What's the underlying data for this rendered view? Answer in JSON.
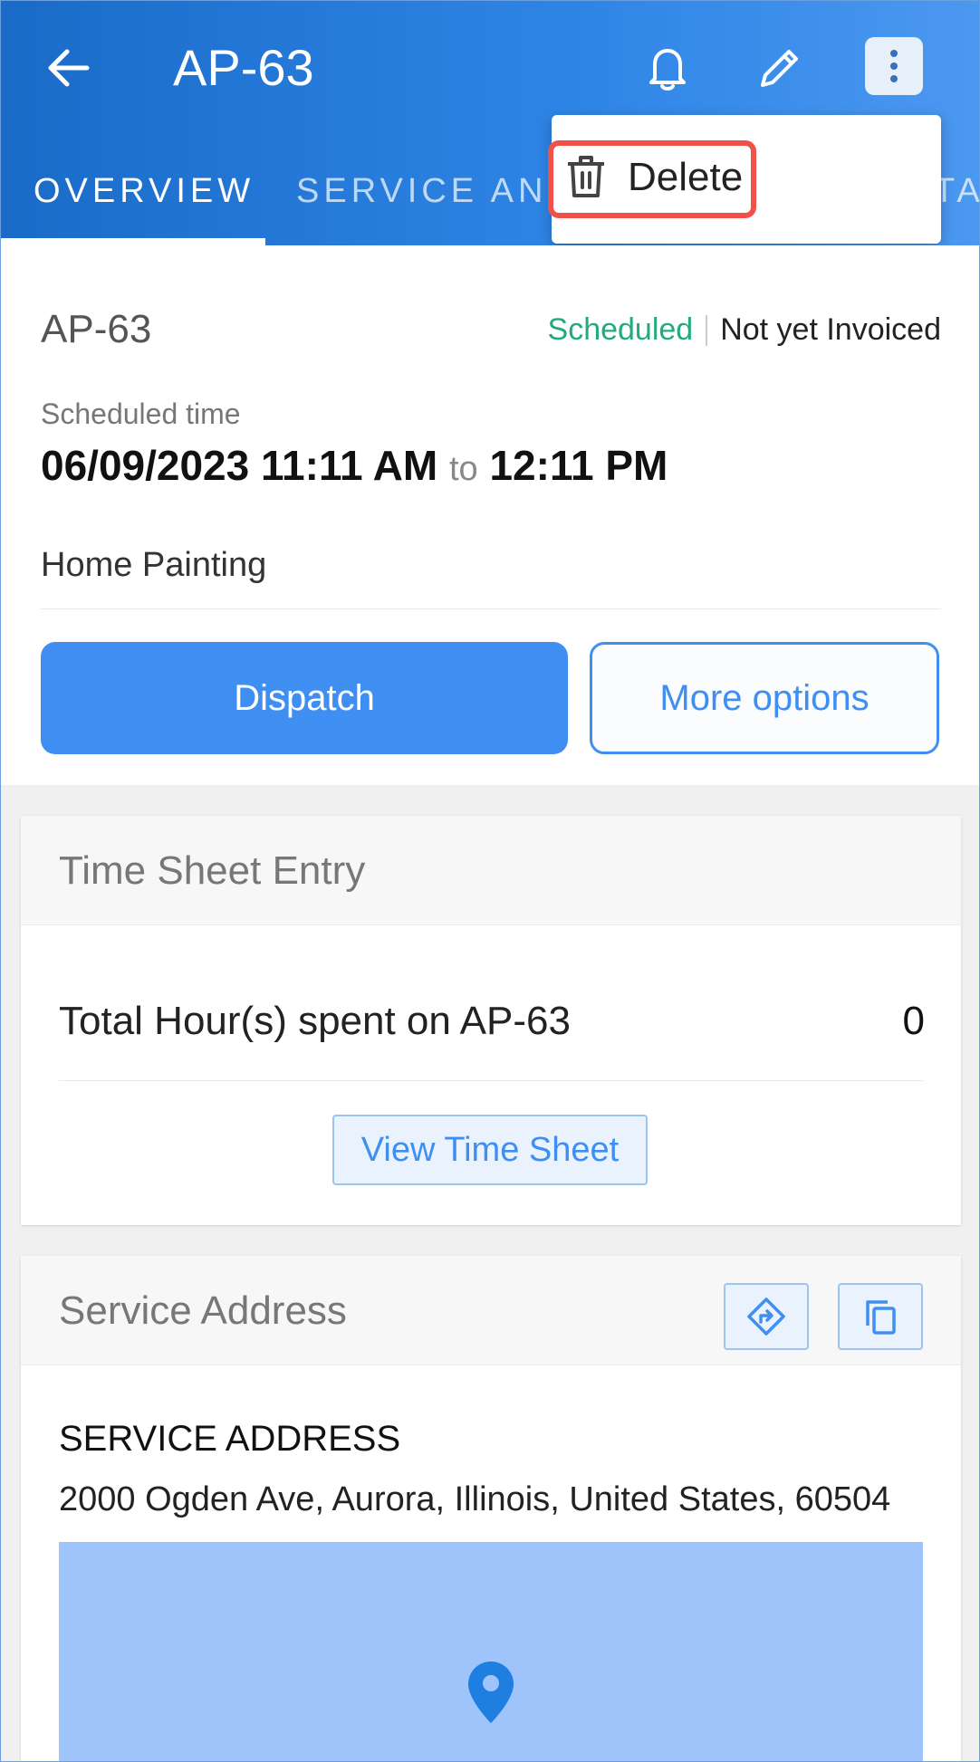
{
  "header": {
    "title": "AP-63",
    "tabs": [
      {
        "label": "OVERVIEW"
      },
      {
        "label": "SERVICE AND"
      },
      {
        "label": "TA"
      }
    ]
  },
  "menu": {
    "items": [
      {
        "label": "Delete",
        "icon": "trash-icon"
      }
    ]
  },
  "job": {
    "id": "AP-63",
    "status": "Scheduled",
    "invoice_status": "Not yet Invoiced",
    "scheduled_label": "Scheduled time",
    "start": "06/09/2023 11:11 AM",
    "to": "to",
    "end": "12:11 PM",
    "type": "Home Painting"
  },
  "actions": {
    "dispatch": "Dispatch",
    "more": "More options"
  },
  "timesheet": {
    "title": "Time Sheet Entry",
    "total_label": "Total Hour(s) spent on AP-63",
    "total_value": "0",
    "view_button": "View Time Sheet"
  },
  "service_address": {
    "title": "Service Address",
    "label": "SERVICE ADDRESS",
    "value": "2000 Ogden Ave, Aurora, Illinois, United States, 60504"
  },
  "colors": {
    "primary": "#3f8ef2",
    "header_start": "#1a6bc8",
    "scheduled": "#22aa80",
    "highlight": "#f0524a",
    "map": "#9fc4fb"
  }
}
